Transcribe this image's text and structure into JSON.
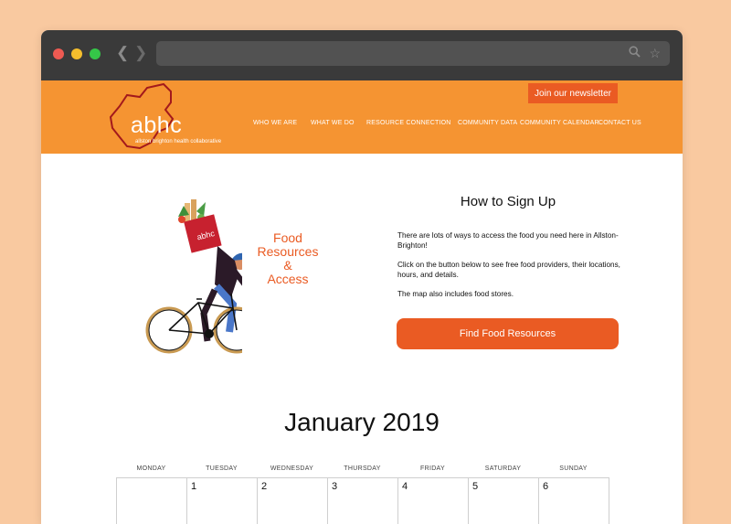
{
  "site": {
    "logo_text": "abhc",
    "logo_tagline": "allston brighton health collaborative",
    "newsletter_label": "Join our newsletter",
    "nav": [
      "WHO WE ARE",
      "WHAT WE DO",
      "RESOURCE CONNECTION",
      "COMMUNITY DATA",
      "COMMUNITY CALENDAR",
      "CONTACT US"
    ],
    "brand_color": "#f59432",
    "accent_color": "#ea5b23"
  },
  "browser": {
    "icons": [
      "back-arrow-icon",
      "forward-arrow-icon",
      "search-icon",
      "star-icon"
    ]
  },
  "hero": {
    "bag_text": "abhc",
    "title_lines": [
      "Food",
      "Resources",
      "&",
      "Access"
    ]
  },
  "signup": {
    "title": "How to Sign Up",
    "p1": "There are lots of ways to access the food you need here in Allston-Brighton!",
    "p2": "Click on the button below to see free food providers, their locations, hours, and details.",
    "p3": "The map also includes food stores.",
    "button": "Find Food Resources"
  },
  "calendar": {
    "month": "January 2019",
    "weekdays": [
      "MONDAY",
      "TUESDAY",
      "WEDNESDAY",
      "THURSDAY",
      "FRIDAY",
      "SATURDAY",
      "SUNDAY"
    ],
    "days": [
      "",
      "1",
      "2",
      "3",
      "4",
      "5",
      "6"
    ]
  }
}
